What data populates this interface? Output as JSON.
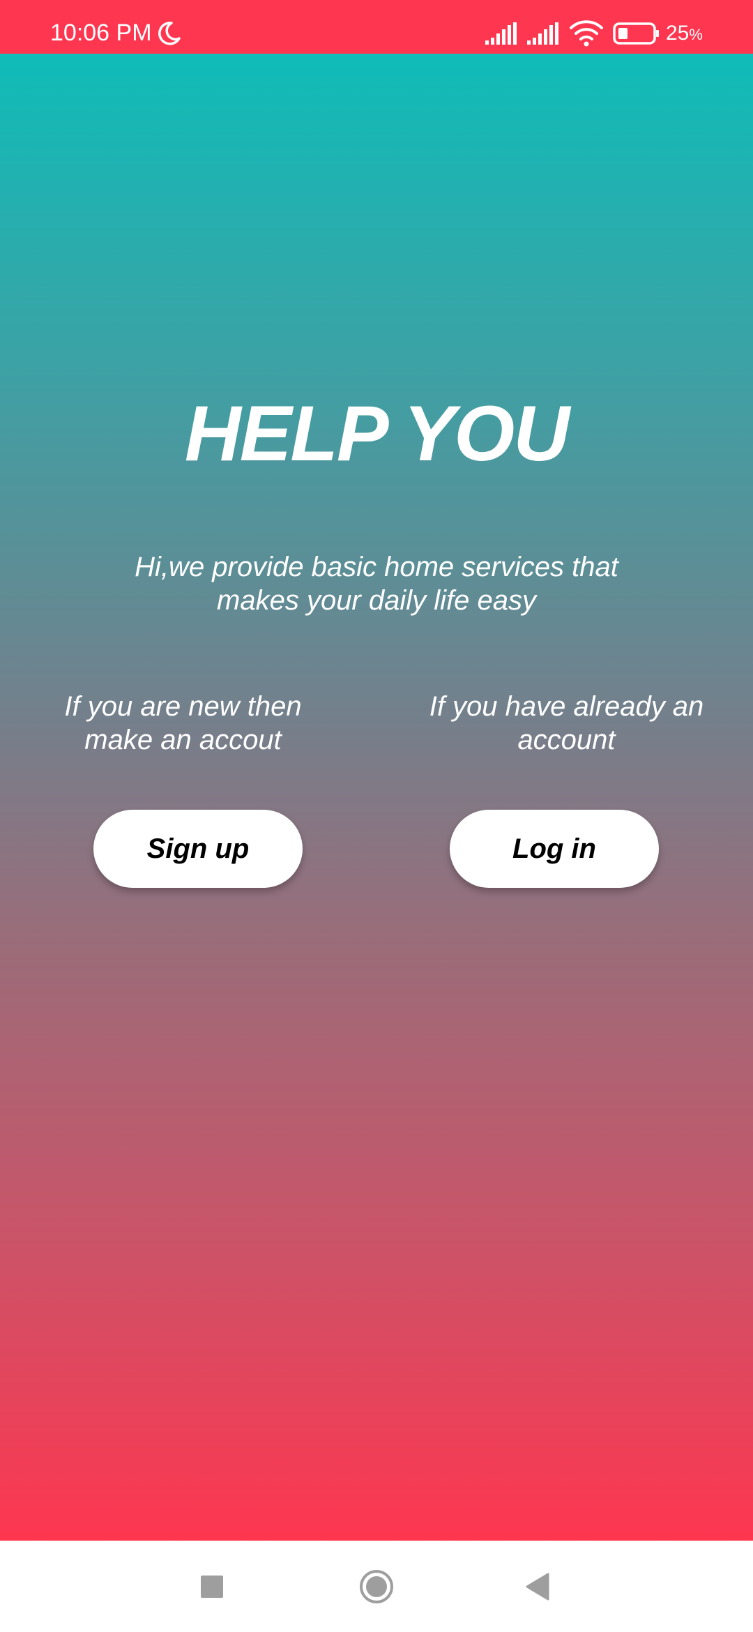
{
  "status_bar": {
    "time": "10:06 PM",
    "battery_value": "25",
    "battery_unit": "%",
    "background_color": "#fe3650",
    "icons": [
      "moon-icon",
      "signal-icon",
      "signal-icon",
      "wifi-icon",
      "battery-icon"
    ]
  },
  "main": {
    "title": "HELP YOU",
    "tagline": "Hi,we provide basic home services that makes your daily life easy",
    "new_user_prompt": "If you are new then make an accout",
    "existing_user_prompt": "If you have already an account",
    "signup_label": "Sign up",
    "login_label": "Log in",
    "gradient_top_color": "#0fbcb8",
    "gradient_bottom_color": "#fe3650"
  },
  "nav_bar": {
    "icons": [
      "recents-icon",
      "home-icon",
      "back-icon"
    ]
  }
}
